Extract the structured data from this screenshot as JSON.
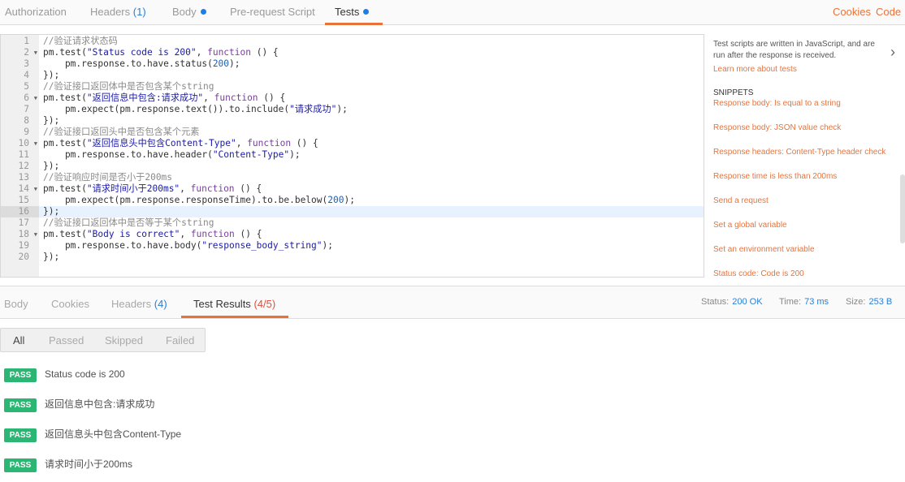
{
  "request_tabs": [
    {
      "label": "Authorization"
    },
    {
      "label": "Headers",
      "count": "(1)"
    },
    {
      "label": "Body",
      "dot": true
    },
    {
      "label": "Pre-request Script"
    },
    {
      "label": "Tests",
      "dot": true,
      "active": true
    }
  ],
  "top_links": {
    "cookies": "Cookies",
    "code": "Code"
  },
  "editor": {
    "highlighted_line": 16,
    "lines": [
      [
        [
          "c",
          "//验证请求状态码"
        ]
      ],
      [
        [
          "p",
          "pm.test("
        ],
        [
          "s",
          "\"Status code is 200\""
        ],
        [
          "p",
          ", "
        ],
        [
          "k",
          "function"
        ],
        [
          "p",
          " () {"
        ]
      ],
      [
        [
          "p",
          "    pm.response.to.have.status("
        ],
        [
          "n",
          "200"
        ],
        [
          "p",
          ");"
        ]
      ],
      [
        [
          "p",
          "});"
        ]
      ],
      [
        [
          "c",
          "//验证接口返回体中是否包含某个string"
        ]
      ],
      [
        [
          "p",
          "pm.test("
        ],
        [
          "s",
          "\"返回信息中包含:请求成功\""
        ],
        [
          "p",
          ", "
        ],
        [
          "k",
          "function"
        ],
        [
          "p",
          " () {"
        ]
      ],
      [
        [
          "p",
          "    pm.expect(pm.response.text()).to.include("
        ],
        [
          "s",
          "\"请求成功\""
        ],
        [
          "p",
          ");"
        ]
      ],
      [
        [
          "p",
          "});"
        ]
      ],
      [
        [
          "c",
          "//验证接口返回头中是否包含某个元素"
        ]
      ],
      [
        [
          "p",
          "pm.test("
        ],
        [
          "s",
          "\"返回信息头中包含Content-Type\""
        ],
        [
          "p",
          ", "
        ],
        [
          "k",
          "function"
        ],
        [
          "p",
          " () {"
        ]
      ],
      [
        [
          "p",
          "    pm.response.to.have.header("
        ],
        [
          "s",
          "\"Content-Type\""
        ],
        [
          "p",
          ");"
        ]
      ],
      [
        [
          "p",
          "});"
        ]
      ],
      [
        [
          "c",
          "//验证响应时间是否小于200ms"
        ]
      ],
      [
        [
          "p",
          "pm.test("
        ],
        [
          "s",
          "\"请求时间小于200ms\""
        ],
        [
          "p",
          ", "
        ],
        [
          "k",
          "function"
        ],
        [
          "p",
          " () {"
        ]
      ],
      [
        [
          "p",
          "    pm.expect(pm.response.responseTime).to.be.below("
        ],
        [
          "n",
          "200"
        ],
        [
          "p",
          ");"
        ]
      ],
      [
        [
          "p",
          "});"
        ]
      ],
      [
        [
          "c",
          "//验证接口返回体中是否等于某个string"
        ]
      ],
      [
        [
          "p",
          "pm.test("
        ],
        [
          "s",
          "\"Body is correct\""
        ],
        [
          "p",
          ", "
        ],
        [
          "k",
          "function"
        ],
        [
          "p",
          " () {"
        ]
      ],
      [
        [
          "p",
          "    pm.response.to.have.body("
        ],
        [
          "s",
          "\"response_body_string\""
        ],
        [
          "p",
          ");"
        ]
      ],
      [
        [
          "p",
          "});"
        ]
      ]
    ],
    "fold_lines": [
      2,
      6,
      10,
      14,
      18
    ]
  },
  "side_panel": {
    "description": "Test scripts are written in JavaScript, and are run after the response is received.",
    "learn_more": "Learn more about tests",
    "snippets_title": "SNIPPETS",
    "snippets": [
      "Response body: Is equal to a string",
      "Response body: JSON value check",
      "Response headers: Content-Type header check",
      "Response time is less than 200ms",
      "Send a request",
      "Set a global variable",
      "Set an environment variable",
      "Status code: Code is 200"
    ]
  },
  "response_tabs": [
    {
      "label": "Body"
    },
    {
      "label": "Cookies"
    },
    {
      "label": "Headers",
      "count": "(4)"
    },
    {
      "label": "Test Results",
      "count": "(4/5)",
      "active": true
    }
  ],
  "status": {
    "status_label": "Status:",
    "status": "200 OK",
    "time_label": "Time:",
    "time": "73 ms",
    "size_label": "Size:",
    "size": "253 B"
  },
  "filters": [
    "All",
    "Passed",
    "Skipped",
    "Failed"
  ],
  "results": [
    {
      "badge": "PASS",
      "name": "Status code is 200"
    },
    {
      "badge": "PASS",
      "name": "返回信息中包含:请求成功"
    },
    {
      "badge": "PASS",
      "name": "返回信息头中包含Content-Type"
    },
    {
      "badge": "PASS",
      "name": "请求时间小于200ms"
    }
  ]
}
